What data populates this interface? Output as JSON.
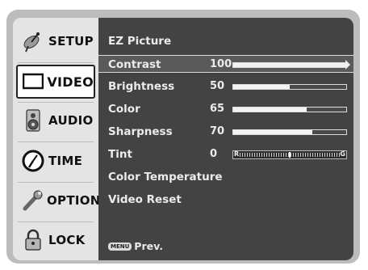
{
  "sidebar": {
    "items": [
      {
        "label": "SETUP",
        "icon": "satellite-dish-icon"
      },
      {
        "label": "VIDEO",
        "icon": "monitor-icon",
        "active": true
      },
      {
        "label": "AUDIO",
        "icon": "speaker-icon"
      },
      {
        "label": "TIME",
        "icon": "clock-icon"
      },
      {
        "label": "OPTION",
        "icon": "wrench-icon"
      },
      {
        "label": "LOCK",
        "icon": "padlock-icon"
      }
    ]
  },
  "menu": {
    "items": [
      {
        "label": "EZ Picture"
      },
      {
        "label": "Contrast",
        "value": "100",
        "level": 1.0,
        "selected": true
      },
      {
        "label": "Brightness",
        "value": "50",
        "level": 0.5
      },
      {
        "label": "Color",
        "value": "65",
        "level": 0.65
      },
      {
        "label": "Sharpness",
        "value": "70",
        "level": 0.7
      },
      {
        "label": "Tint",
        "value": "0",
        "tint_left": "R",
        "tint_right": "G",
        "level": 0.5
      },
      {
        "label": "Color Temperature"
      },
      {
        "label": "Video Reset"
      }
    ],
    "footer": {
      "key": "MENU",
      "label": "Prev."
    }
  },
  "colors": {
    "panel": "#434343",
    "sidebar": "#e4e4e4",
    "frame": "#bcbcbc"
  }
}
